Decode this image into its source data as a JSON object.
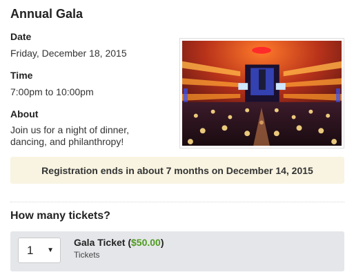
{
  "event": {
    "title": "Annual Gala",
    "date_label": "Date",
    "date_value": "Friday, December 18, 2015",
    "time_label": "Time",
    "time_value": "7:00pm to 10:00pm",
    "about_label": "About",
    "about_text": "Join us for a night of dinner, dancing, and philanthropy!"
  },
  "notice": {
    "text": "Registration ends in about 7 months on December 14, 2015"
  },
  "tickets": {
    "heading": "How many tickets?",
    "items": [
      {
        "quantity": "1",
        "name": "Gala Ticket",
        "price": "$50.00",
        "category": "Tickets"
      }
    ]
  },
  "colors": {
    "notice_bg": "#f8f4e1",
    "ticket_row_bg": "#e4e6e9",
    "price": "#4f9a1f"
  },
  "icons": {
    "caret": "caret-down-icon"
  }
}
